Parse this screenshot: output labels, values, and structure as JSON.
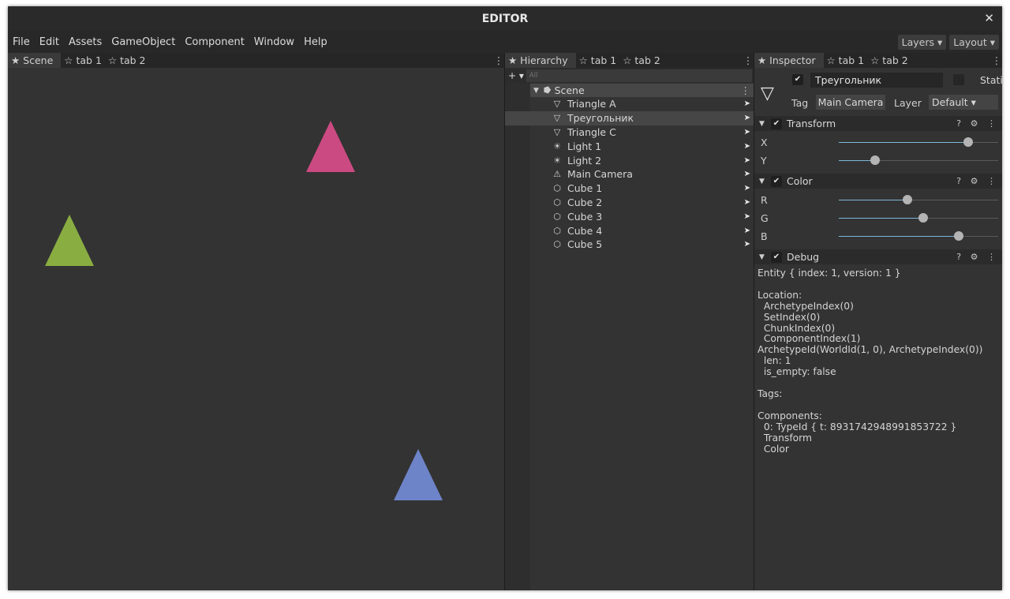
{
  "window": {
    "title": "EDITOR",
    "close_glyph": "✕"
  },
  "menu": {
    "items": [
      "File",
      "Edit",
      "Assets",
      "GameObject",
      "Component",
      "Window",
      "Help"
    ],
    "layers_label": "Layers ▾",
    "layout_label": "Layout ▾"
  },
  "scene_panel": {
    "tabs": [
      "★ Scene",
      "☆ tab 1",
      "☆ tab 2"
    ],
    "triangles": [
      {
        "name": "pink-triangle",
        "color": "#cc4a82"
      },
      {
        "name": "green-triangle",
        "color": "#8aad42"
      },
      {
        "name": "blue-triangle",
        "color": "#6e84c8"
      }
    ]
  },
  "hierarchy": {
    "tabs": [
      "★ Hierarchy",
      "☆ tab 1",
      "☆ tab 2"
    ],
    "add_label": "+ ▾",
    "search_placeholder": "All",
    "root": {
      "label": "Scene",
      "icon": "⭓"
    },
    "items": [
      {
        "icon": "▽",
        "label": "Triangle A"
      },
      {
        "icon": "▽",
        "label": "Треугольник",
        "selected": true
      },
      {
        "icon": "▽",
        "label": "Triangle C"
      },
      {
        "icon": "☀",
        "label": "Light 1"
      },
      {
        "icon": "☀",
        "label": "Light 2"
      },
      {
        "icon": "⚠",
        "label": "Main Camera"
      },
      {
        "icon": "⬡",
        "label": "Cube 1"
      },
      {
        "icon": "⬡",
        "label": "Cube 2"
      },
      {
        "icon": "⬡",
        "label": "Cube 3"
      },
      {
        "icon": "⬡",
        "label": "Cube 4"
      },
      {
        "icon": "⬡",
        "label": "Cube 5"
      }
    ],
    "row_arrow": "➤"
  },
  "inspector": {
    "tabs": [
      "★ Inspector",
      "☆ tab 1",
      "☆ tab 2"
    ],
    "icon_glyph": "▽",
    "name_value": "Треугольник",
    "static_label": "Static",
    "tag_label": "Tag",
    "tag_value": "Main Camera",
    "layer_label": "Layer",
    "layer_value": "Default ▾",
    "components": {
      "transform": {
        "title": "Transform",
        "props": [
          {
            "label": "X",
            "value": 0.81
          },
          {
            "label": "Y",
            "value": 0.23
          }
        ]
      },
      "color": {
        "title": "Color",
        "props": [
          {
            "label": "R",
            "value": 0.43
          },
          {
            "label": "G",
            "value": 0.53
          },
          {
            "label": "B",
            "value": 0.75
          }
        ]
      },
      "debug": {
        "title": "Debug",
        "text": "Entity { index: 1, version: 1 }\n\nLocation:\n  ArchetypeIndex(0)\n  SetIndex(0)\n  ChunkIndex(0)\n  ComponentIndex(1)\nArchetypeId(WorldId(1, 0), ArchetypeIndex(0))\n  len: 1\n  is_empty: false\n\nTags:\n\nComponents:\n  0: TypeId { t: 8931742948991853722 }\n  Transform\n  Color"
      }
    },
    "header_icons": "? ⚙ ⋮"
  },
  "colors": {
    "accent": "#7fb7d8",
    "background": "#333333"
  }
}
